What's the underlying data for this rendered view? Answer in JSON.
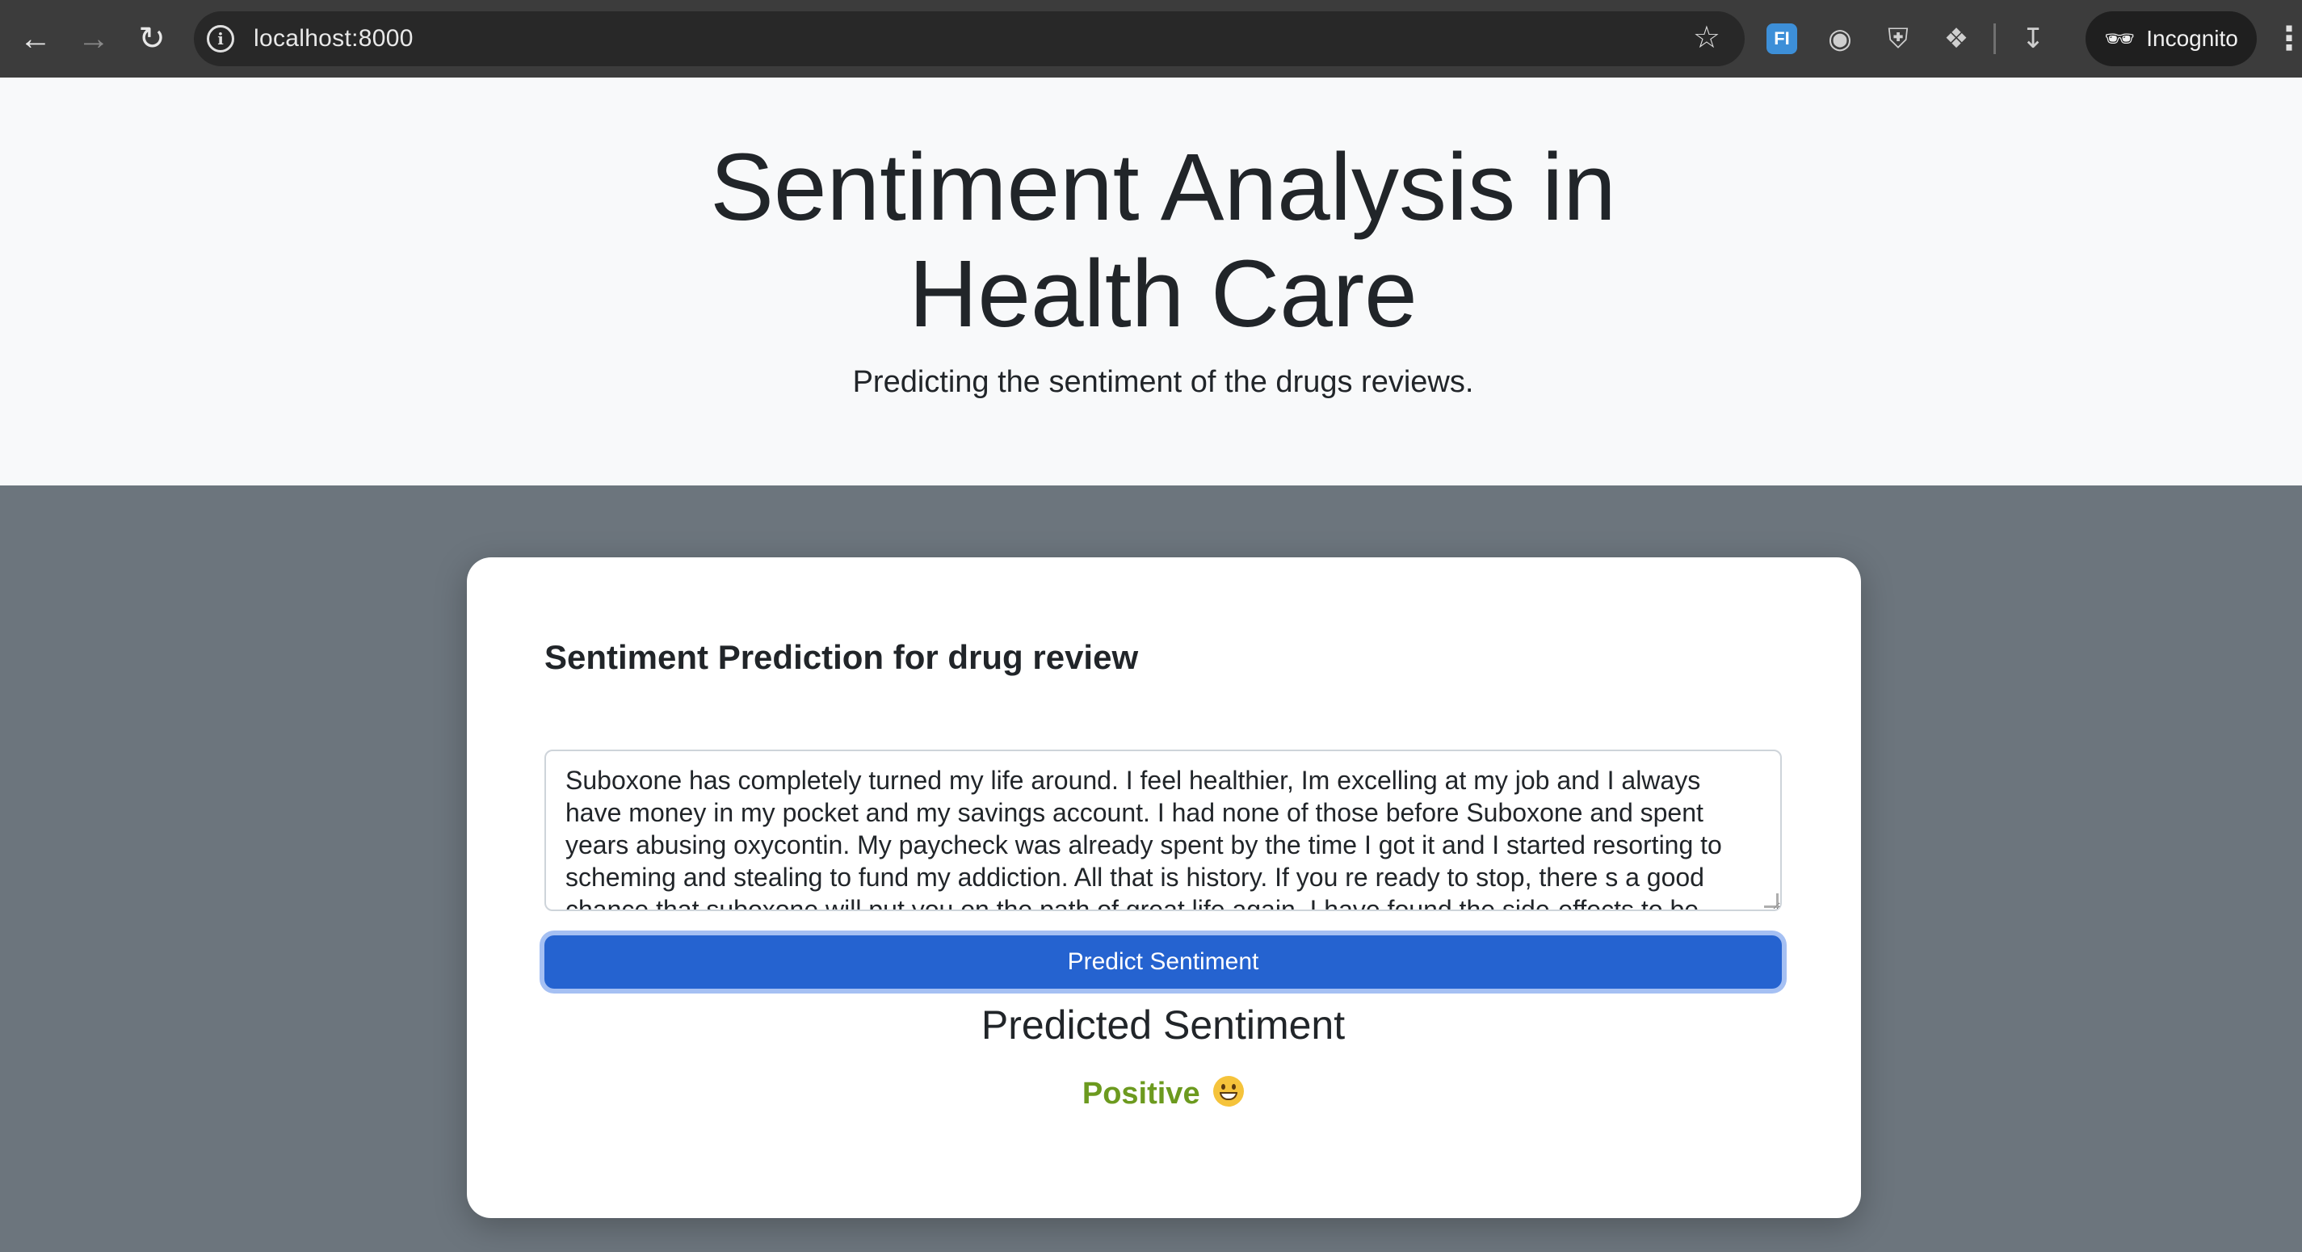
{
  "browser": {
    "url": "localhost:8000",
    "incognito_label": "Incognito",
    "extension_badge": "FI",
    "icons": [
      "back-arrow-icon",
      "forward-arrow-icon",
      "reload-icon",
      "info-icon",
      "star-icon",
      "camera-icon",
      "shield-icon",
      "puzzle-icon",
      "download-icon",
      "incognito-icon",
      "menu-dots-icon"
    ]
  },
  "hero": {
    "title_line1": "Sentiment Analysis in",
    "title_line2": "Health Care",
    "subtitle": "Predicting the sentiment of the drugs reviews."
  },
  "card": {
    "heading": "Sentiment Prediction for drug review",
    "review_text": "Suboxone has completely turned my life around.  I feel healthier, Im excelling at my job and I always have money in my pocket and my savings account.  I had none of those before Suboxone and spent years abusing oxycontin.  My paycheck was already spent by the time I got it and I started resorting to scheming and stealing to fund my addiction.  All that is history.  If you re ready to stop, there s a good chance that suboxone will put you on the path of great life again.  I have found the side-effects to be",
    "button_label": "Predict Sentiment",
    "result_heading": "Predicted Sentiment",
    "result_value": "Positive",
    "result_emoji": "grinning-face-icon"
  },
  "colors": {
    "hero_bg": "#f8f9fa",
    "page_bg": "#6c757d",
    "button_bg": "#2563d0",
    "positive_text": "#6c9a1f"
  }
}
